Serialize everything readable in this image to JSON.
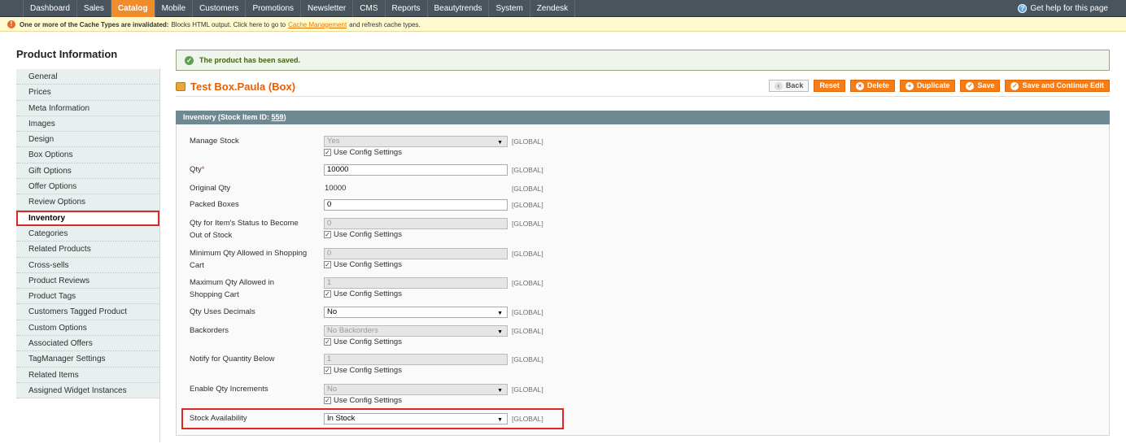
{
  "nav": {
    "items": [
      {
        "label": "Dashboard"
      },
      {
        "label": "Sales"
      },
      {
        "label": "Catalog",
        "active": true
      },
      {
        "label": "Mobile"
      },
      {
        "label": "Customers"
      },
      {
        "label": "Promotions"
      },
      {
        "label": "Newsletter"
      },
      {
        "label": "CMS"
      },
      {
        "label": "Reports"
      },
      {
        "label": "Beautytrends"
      },
      {
        "label": "System"
      },
      {
        "label": "Zendesk"
      }
    ],
    "help_label": "Get help for this page",
    "help_icon": "help-circle-icon"
  },
  "notice": {
    "bold": "One or more of the Cache Types are invalidated:",
    "text1": "Blocks HTML output. Click here to go to",
    "link": "Cache Management",
    "text2": "and refresh cache types."
  },
  "sidebar": {
    "title": "Product Information",
    "items": [
      "General",
      "Prices",
      "Meta Information",
      "Images",
      "Design",
      "Box Options",
      "Gift Options",
      "Offer Options",
      "Review Options",
      "Inventory",
      "Categories",
      "Related Products",
      "Cross-sells",
      "Product Reviews",
      "Product Tags",
      "Customers Tagged Product",
      "Custom Options",
      "Associated Offers",
      "TagManager Settings",
      "Related Items",
      "Assigned Widget Instances"
    ],
    "active_index": 9
  },
  "success_message": "The product has been saved.",
  "product_title": "Test Box.Paula (Box)",
  "buttons": {
    "back": "Back",
    "reset": "Reset",
    "delete": "Delete",
    "duplicate": "Duplicate",
    "save": "Save",
    "save_continue": "Save and Continue Edit"
  },
  "fieldset": {
    "title": "Inventory (Stock Item ID:",
    "stock_id": "559",
    "title_end": ")"
  },
  "fields": {
    "manage_stock": {
      "label": "Manage Stock",
      "value": "Yes",
      "use_config": "Use Config Settings",
      "scope": "[GLOBAL]"
    },
    "qty": {
      "label": "Qty",
      "required": "*",
      "value": "10000",
      "scope": "[GLOBAL]"
    },
    "original_qty": {
      "label": "Original Qty",
      "value": "10000",
      "scope": "[GLOBAL]"
    },
    "packed_boxes": {
      "label": "Packed Boxes",
      "value": "0",
      "scope": "[GLOBAL]"
    },
    "out_of_stock": {
      "label1": "Qty for Item's Status to Become",
      "label2": "Out of Stock",
      "value": "0",
      "use_config": "Use Config Settings",
      "scope": "[GLOBAL]"
    },
    "min_qty": {
      "label1": "Minimum Qty Allowed in Shopping",
      "label2": "Cart",
      "value": "0",
      "use_config": "Use Config Settings",
      "scope": "[GLOBAL]"
    },
    "max_qty": {
      "label1": "Maximum Qty Allowed in",
      "label2": "Shopping Cart",
      "value": "1",
      "use_config": "Use Config Settings",
      "scope": "[GLOBAL]"
    },
    "qty_decimals": {
      "label": "Qty Uses Decimals",
      "value": "No",
      "scope": "[GLOBAL]"
    },
    "backorders": {
      "label": "Backorders",
      "value": "No Backorders",
      "use_config": "Use Config Settings",
      "scope": "[GLOBAL]"
    },
    "notify_below": {
      "label": "Notify for Quantity Below",
      "value": "1",
      "use_config": "Use Config Settings",
      "scope": "[GLOBAL]"
    },
    "qty_increments": {
      "label": "Enable Qty Increments",
      "value": "No",
      "use_config": "Use Config Settings",
      "scope": "[GLOBAL]"
    },
    "stock_availability": {
      "label": "Stock Availability",
      "value": "In Stock",
      "scope": "[GLOBAL]"
    }
  },
  "colors": {
    "nav_bg": "#4a545c",
    "nav_active": "#f08c2a",
    "accent_orange": "#eb5e00",
    "highlight_red": "#e02727",
    "fieldset_head": "#6f8992"
  }
}
